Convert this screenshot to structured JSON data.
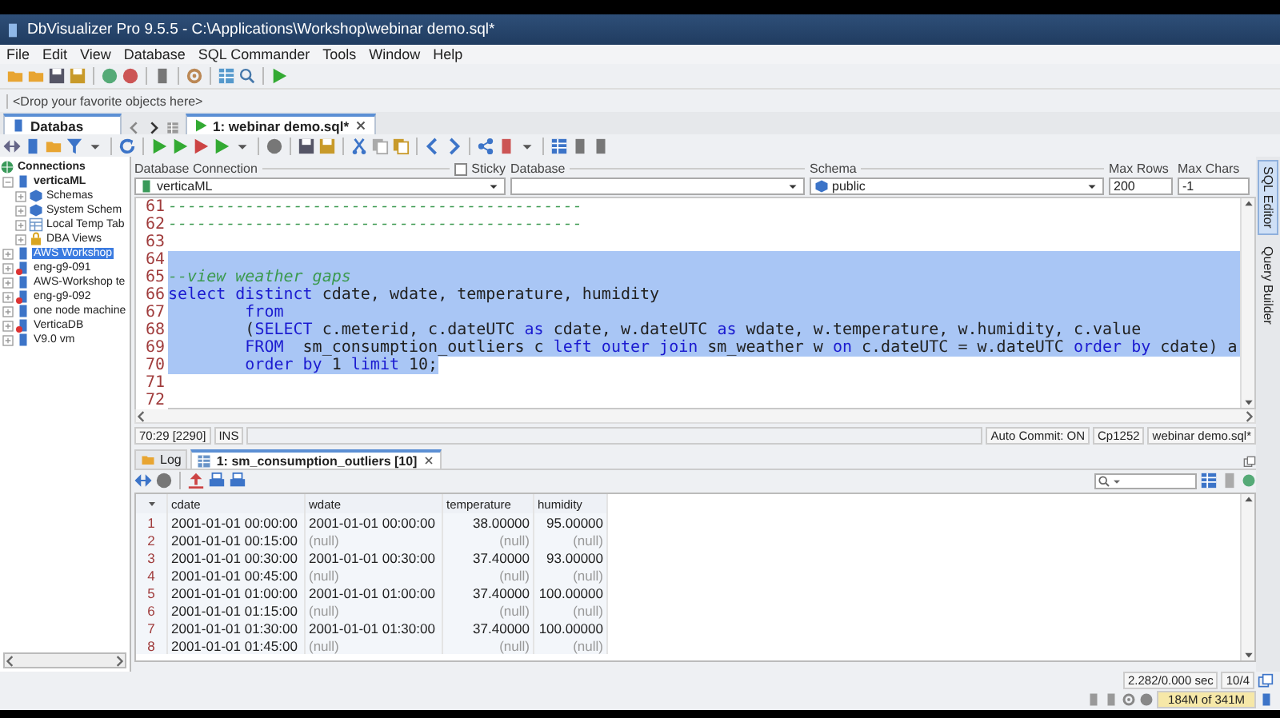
{
  "window": {
    "title": "DbVisualizer Pro 9.5.5 - C:\\Applications\\Workshop\\webinar demo.sql*"
  },
  "menu": [
    "File",
    "Edit",
    "View",
    "Database",
    "SQL Commander",
    "Tools",
    "Window",
    "Help"
  ],
  "favorites_bar": {
    "placeholder": "<Drop your favorite objects here>"
  },
  "left_tab": {
    "label": "Databas"
  },
  "editor_tabs": [
    {
      "label": "1: webinar demo.sql*",
      "selected": true
    }
  ],
  "connection_form": {
    "connection_label": "Database Connection",
    "connection": "verticaML",
    "sticky_label": "Sticky",
    "sticky_checked": false,
    "database_label": "Database",
    "schema_label": "Schema",
    "schema": "public",
    "max_rows_label": "Max Rows",
    "max_rows": "200",
    "max_chars_label": "Max Chars",
    "max_chars": "-1"
  },
  "side_tabs": [
    {
      "label": "SQL Editor",
      "selected": true
    },
    {
      "label": "Query Builder",
      "selected": false
    }
  ],
  "tree": {
    "root": "Connections",
    "children": [
      {
        "label": "verticaML",
        "expanded": true,
        "selected": false,
        "error": false,
        "children": [
          {
            "label": "Schemas",
            "kind": "schemas"
          },
          {
            "label": "System Schem",
            "kind": "schemas"
          },
          {
            "label": "Local Temp Tab",
            "kind": "tables"
          },
          {
            "label": "DBA Views",
            "kind": "locked"
          }
        ]
      },
      {
        "label": "AWS Workshop",
        "expanded": false,
        "selected": true,
        "error": false
      },
      {
        "label": "eng-g9-091",
        "expanded": false,
        "selected": false,
        "error": true
      },
      {
        "label": "AWS-Workshop te",
        "expanded": false,
        "selected": false,
        "error": false
      },
      {
        "label": "eng-g9-092",
        "expanded": false,
        "selected": false,
        "error": true
      },
      {
        "label": "one node machine",
        "expanded": false,
        "selected": false,
        "error": false
      },
      {
        "label": "VerticaDB",
        "expanded": false,
        "selected": false,
        "error": true
      },
      {
        "label": "V9.0 vm",
        "expanded": false,
        "selected": false,
        "error": false
      }
    ]
  },
  "editor": {
    "lines": [
      {
        "number": "61",
        "selected": false,
        "segments": [
          {
            "kind": "comment",
            "text": "-------------------------------------------"
          }
        ]
      },
      {
        "number": "62",
        "selected": false,
        "segments": [
          {
            "kind": "comment",
            "text": "-------------------------------------------"
          }
        ]
      },
      {
        "number": "63",
        "selected": false
      },
      {
        "number": "64",
        "selected": true
      },
      {
        "number": "65",
        "selected": true,
        "segments": [
          {
            "kind": "comment",
            "text": "--view weather gaps"
          }
        ]
      },
      {
        "number": "66",
        "selected": true,
        "segments": [
          {
            "kind": "keyword",
            "text": "select distinct"
          },
          {
            "kind": "plain",
            "text": " cdate, wdate, temperature, humidity"
          }
        ]
      },
      {
        "number": "67",
        "selected": true,
        "indented": true,
        "segments": [
          {
            "kind": "keyword",
            "text": "from"
          }
        ]
      },
      {
        "number": "68",
        "selected": true,
        "indented": true,
        "segments": [
          {
            "kind": "plain",
            "text": "("
          },
          {
            "kind": "keyword",
            "text": "SELECT"
          },
          {
            "kind": "plain",
            "text": " c.meterid, c.dateUTC "
          },
          {
            "kind": "keyword",
            "text": "as"
          },
          {
            "kind": "plain",
            "text": " cdate, w.dateUTC "
          },
          {
            "kind": "keyword",
            "text": "as"
          },
          {
            "kind": "plain",
            "text": " wdate, w.temperature, w.humidity, c.value"
          }
        ]
      },
      {
        "number": "69",
        "selected": true,
        "indented": true,
        "segments": [
          {
            "kind": "keyword",
            "text": "FROM"
          },
          {
            "kind": "plain",
            "text": "  sm_consumption_outliers c "
          },
          {
            "kind": "keyword",
            "text": "left outer join"
          },
          {
            "kind": "plain",
            "text": " sm_weather w "
          },
          {
            "kind": "keyword",
            "text": "on"
          },
          {
            "kind": "plain",
            "text": " c.dateUTC = w.dateUTC "
          },
          {
            "kind": "keyword",
            "text": "order by"
          },
          {
            "kind": "plain",
            "text": " cdate) a"
          }
        ]
      },
      {
        "number": "70",
        "selected": true,
        "indented": true,
        "segments": [
          {
            "kind": "keyword",
            "text": "order by"
          },
          {
            "kind": "plain",
            "text": " 1 "
          },
          {
            "kind": "keyword",
            "text": "limit"
          },
          {
            "kind": "plain",
            "text": " 10;"
          }
        ]
      },
      {
        "number": "71",
        "selected": false
      },
      {
        "number": "72",
        "selected": false
      }
    ]
  },
  "editor_status": {
    "position": "70:29 [2290]",
    "mode": "INS",
    "auto_commit": "Auto Commit: ON",
    "encoding": "Cp1252",
    "file": "webinar demo.sql*"
  },
  "result_tabs": [
    {
      "label": "Log",
      "selected": false
    },
    {
      "label": "1: sm_consumption_outliers [10]",
      "selected": true
    }
  ],
  "table": {
    "columns": [
      {
        "label": "cdate",
        "kind": "text"
      },
      {
        "label": "wdate",
        "kind": "text"
      },
      {
        "label": "temperature",
        "kind": "number"
      },
      {
        "label": "humidity",
        "kind": "number"
      }
    ],
    "rows": [
      {
        "number": "1",
        "cells": [
          {
            "text": "2001-01-01 00:00:00",
            "null": false
          },
          {
            "text": "2001-01-01 00:00:00",
            "null": false
          },
          {
            "text": "38.00000",
            "null": false
          },
          {
            "text": "95.00000",
            "null": false
          }
        ]
      },
      {
        "number": "2",
        "cells": [
          {
            "text": "2001-01-01 00:15:00",
            "null": false
          },
          {
            "text": "(null)",
            "null": true
          },
          {
            "text": "(null)",
            "null": true
          },
          {
            "text": "(null)",
            "null": true
          }
        ]
      },
      {
        "number": "3",
        "cells": [
          {
            "text": "2001-01-01 00:30:00",
            "null": false
          },
          {
            "text": "2001-01-01 00:30:00",
            "null": false
          },
          {
            "text": "37.40000",
            "null": false
          },
          {
            "text": "93.00000",
            "null": false
          }
        ]
      },
      {
        "number": "4",
        "cells": [
          {
            "text": "2001-01-01 00:45:00",
            "null": false
          },
          {
            "text": "(null)",
            "null": true
          },
          {
            "text": "(null)",
            "null": true
          },
          {
            "text": "(null)",
            "null": true
          }
        ]
      },
      {
        "number": "5",
        "cells": [
          {
            "text": "2001-01-01 01:00:00",
            "null": false
          },
          {
            "text": "2001-01-01 01:00:00",
            "null": false
          },
          {
            "text": "37.40000",
            "null": false
          },
          {
            "text": "100.00000",
            "null": false
          }
        ]
      },
      {
        "number": "6",
        "cells": [
          {
            "text": "2001-01-01 01:15:00",
            "null": false
          },
          {
            "text": "(null)",
            "null": true
          },
          {
            "text": "(null)",
            "null": true
          },
          {
            "text": "(null)",
            "null": true
          }
        ]
      },
      {
        "number": "7",
        "cells": [
          {
            "text": "2001-01-01 01:30:00",
            "null": false
          },
          {
            "text": "2001-01-01 01:30:00",
            "null": false
          },
          {
            "text": "37.40000",
            "null": false
          },
          {
            "text": "100.00000",
            "null": false
          }
        ]
      },
      {
        "number": "8",
        "cells": [
          {
            "text": "2001-01-01 01:45:00",
            "null": false
          },
          {
            "text": "(null)",
            "null": true
          },
          {
            "text": "(null)",
            "null": true
          },
          {
            "text": "(null)",
            "null": true
          }
        ]
      }
    ]
  },
  "result_status": {
    "timing": "2.282/0.000 sec",
    "rows": "10/4",
    "memory": "184M of 341M"
  }
}
